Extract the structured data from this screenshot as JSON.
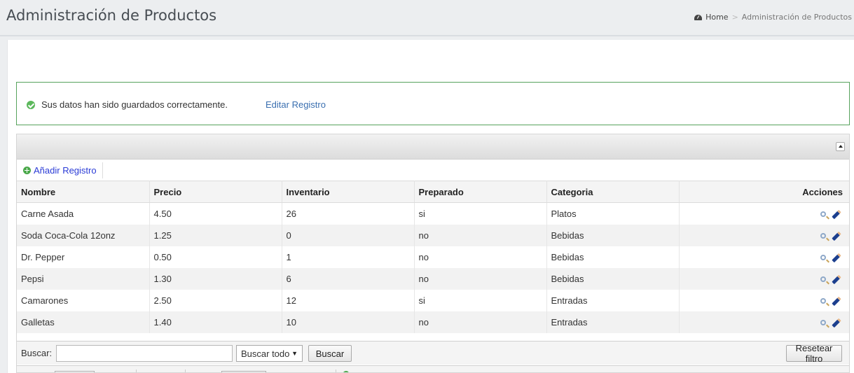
{
  "header": {
    "title": "Administración de Productos",
    "breadcrumb": {
      "home": "Home",
      "separator": ">",
      "current": "Administración de Productos"
    }
  },
  "alert": {
    "message": "Sus datos han sido guardados correctamente.",
    "link": "Editar Registro",
    "color": "#57a35d"
  },
  "toolbar": {
    "add_label": "Añadir Registro"
  },
  "table": {
    "columns": [
      "Nombre",
      "Precio",
      "Inventario",
      "Preparado",
      "Categoria",
      "Acciones"
    ],
    "rows": [
      [
        "Carne Asada",
        "4.50",
        "26",
        "si",
        "Platos"
      ],
      [
        "Soda Coca-Cola 12onz",
        "1.25",
        "0",
        "no",
        "Bebidas"
      ],
      [
        "Dr. Pepper",
        "0.50",
        "1",
        "no",
        "Bebidas"
      ],
      [
        "Pepsi",
        "1.30",
        "6",
        "no",
        "Bebidas"
      ],
      [
        "Camarones",
        "2.50",
        "12",
        "si",
        "Entradas"
      ],
      [
        "Galletas",
        "1.40",
        "10",
        "no",
        "Entradas"
      ]
    ],
    "action_icons": [
      "magnifier-icon",
      "pencil-icon"
    ]
  },
  "search": {
    "label": "Buscar:",
    "value": "",
    "select_value": "Buscar todo",
    "button": "Buscar",
    "reset_button": "Resetear filtro"
  }
}
